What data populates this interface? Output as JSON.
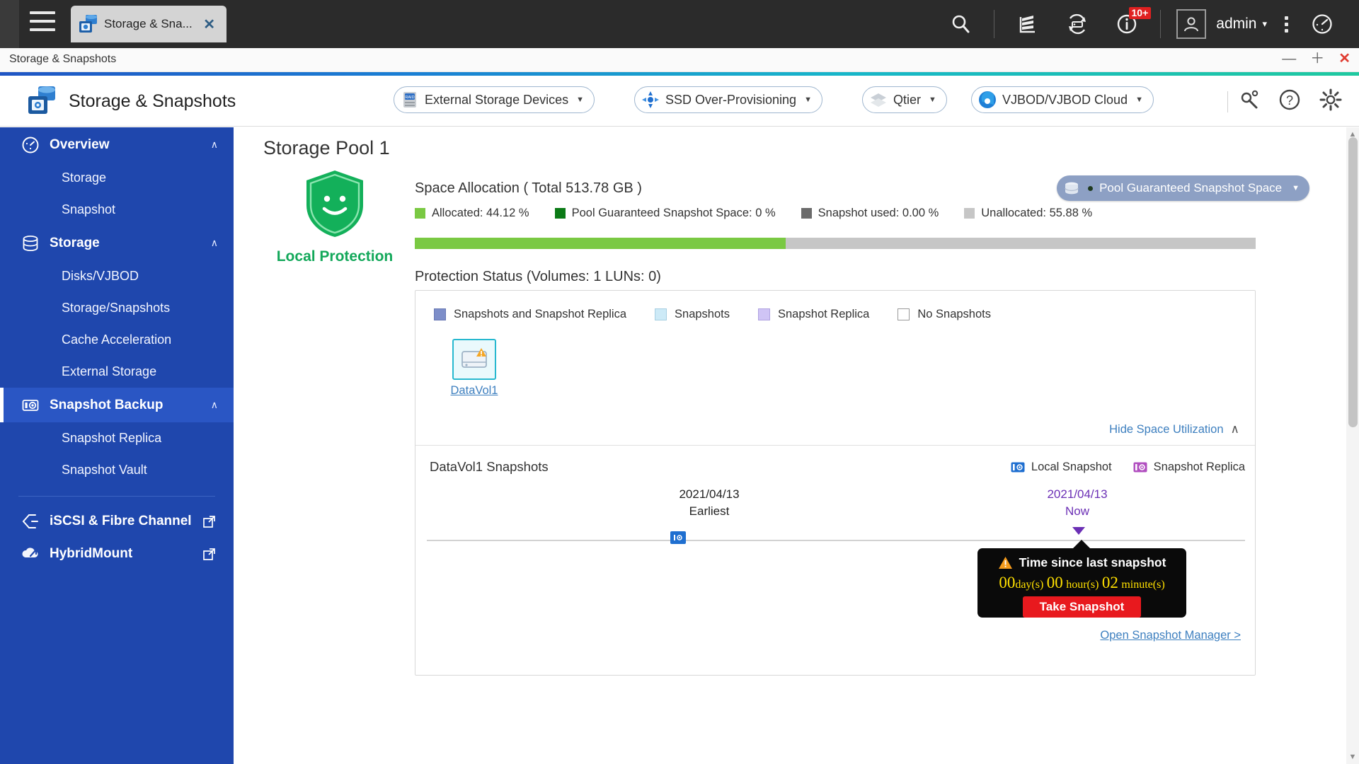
{
  "os_bar": {
    "menu_icon": "hamburger-icon",
    "tab": {
      "label": "Storage & Sna...",
      "icon": "storage-snapshots-icon",
      "close": "✕"
    },
    "icons": [
      {
        "name": "search-icon"
      },
      {
        "name": "resource-monitor-icon"
      },
      {
        "name": "backup-sync-icon"
      },
      {
        "name": "notification-info-icon",
        "badge": "10+"
      }
    ],
    "user": {
      "name": "admin",
      "avatar": "user-avatar-icon",
      "caret": "▾"
    },
    "more_icon": "kebab-menu-icon",
    "dashboard_icon": "dashboard-gauge-icon"
  },
  "window": {
    "title": "Storage & Snapshots",
    "minimize": "—",
    "maximize": "＋",
    "close": "✕"
  },
  "app_header": {
    "title": "Storage & Snapshots",
    "logo": "storage-snapshots-logo",
    "pills": [
      {
        "label": "External Storage Devices",
        "icon": "raid-disk-icon",
        "caret": "▼"
      },
      {
        "label": "SSD Over-Provisioning",
        "icon": "ssd-icon",
        "caret": "▼"
      },
      {
        "label": "Qtier",
        "icon": "qtier-layers-icon",
        "caret": "▼"
      },
      {
        "label": "VJBOD/VJBOD Cloud",
        "icon": "vjbod-cloud-icon",
        "caret": "▼"
      }
    ],
    "tools": [
      {
        "name": "storage-tools-icon"
      },
      {
        "name": "help-icon"
      },
      {
        "name": "settings-gear-icon"
      }
    ]
  },
  "sidebar": {
    "groups": [
      {
        "label": "Overview",
        "icon": "gauge-icon",
        "chevron": "∧",
        "active": false,
        "children": [
          {
            "label": "Storage"
          },
          {
            "label": "Snapshot"
          }
        ]
      },
      {
        "label": "Storage",
        "icon": "database-icon",
        "chevron": "∧",
        "active": false,
        "children": [
          {
            "label": "Disks/VJBOD"
          },
          {
            "label": "Storage/Snapshots"
          },
          {
            "label": "Cache Acceleration"
          },
          {
            "label": "External Storage"
          }
        ]
      },
      {
        "label": "Snapshot Backup",
        "icon": "snapshot-camera-icon",
        "chevron": "∧",
        "active": true,
        "children": [
          {
            "label": "Snapshot Replica"
          },
          {
            "label": "Snapshot Vault"
          }
        ]
      }
    ],
    "links": [
      {
        "label": "iSCSI & Fibre Channel",
        "icon": "iscsi-icon",
        "external": "external-link-icon"
      },
      {
        "label": "HybridMount",
        "icon": "hybridmount-cloud-icon",
        "external": "external-link-icon"
      }
    ]
  },
  "main": {
    "pool_title": "Storage Pool 1",
    "shield": {
      "icon": "green-shield-smiley-icon",
      "caption": "Local Protection"
    },
    "space_allocation": {
      "title": "Space Allocation ( Total 513.78 GB )",
      "total": "513.78 GB",
      "legend": [
        {
          "label": "Allocated: 44.12 %",
          "color": "#7ac943",
          "value": 44.12
        },
        {
          "label": "Pool Guaranteed Snapshot Space: 0 %",
          "color": "#0b7a16",
          "value": 0
        },
        {
          "label": "Snapshot used: 0.00 %",
          "color": "#6b6b6b",
          "value": 0.0
        },
        {
          "label": "Unallocated: 55.88 %",
          "color": "#c6c6c6",
          "value": 55.88
        }
      ],
      "bar_fill_percent": 44.12
    },
    "pgss_button": {
      "label": "Pool Guaranteed Snapshot Space",
      "icon": "pool-space-icon",
      "caret": "▼"
    },
    "protection_status": {
      "title": "Protection Status (Volumes: 1 LUNs: 0)",
      "legend": [
        {
          "label": "Snapshots and Snapshot Replica",
          "color": "#7d8ec9"
        },
        {
          "label": "Snapshots",
          "color": "#cdeaf7"
        },
        {
          "label": "Snapshot Replica",
          "color": "#cfc4f5"
        },
        {
          "label": "No Snapshots",
          "color": "#ffffff"
        }
      ],
      "volumes": [
        {
          "name": "DataVol1",
          "icon": "volume-warning-icon"
        }
      ]
    },
    "hide_space_utilization": {
      "label": "Hide Space Utilization",
      "chevron": "∧"
    },
    "snapshot_section": {
      "title": "DataVol1 Snapshots",
      "types": [
        {
          "label": "Local Snapshot",
          "icon": "local-snapshot-icon",
          "color": "#1f6fd0"
        },
        {
          "label": "Snapshot Replica",
          "icon": "snapshot-replica-icon",
          "color": "#b14fc0"
        }
      ],
      "timeline": {
        "earliest_date": "2021/04/13",
        "earliest_label": "Earliest",
        "now_date": "2021/04/13",
        "now_label": "Now"
      },
      "tooltip": {
        "warn_icon": "warning-triangle-icon",
        "title": "Time since last snapshot",
        "days": "00",
        "days_unit": "day(s)",
        "hours": "00",
        "hours_unit": "hour(s)",
        "minutes": "02",
        "minutes_unit": "minute(s)",
        "button": "Take Snapshot"
      },
      "open_manager_link": "Open Snapshot Manager >"
    }
  },
  "colors": {
    "sidebar_bg": "#1f47ad",
    "sidebar_active": "#2a56c4",
    "accent_green": "#7ac943",
    "link_blue": "#3d7fbf",
    "danger_red": "#e8191e"
  }
}
